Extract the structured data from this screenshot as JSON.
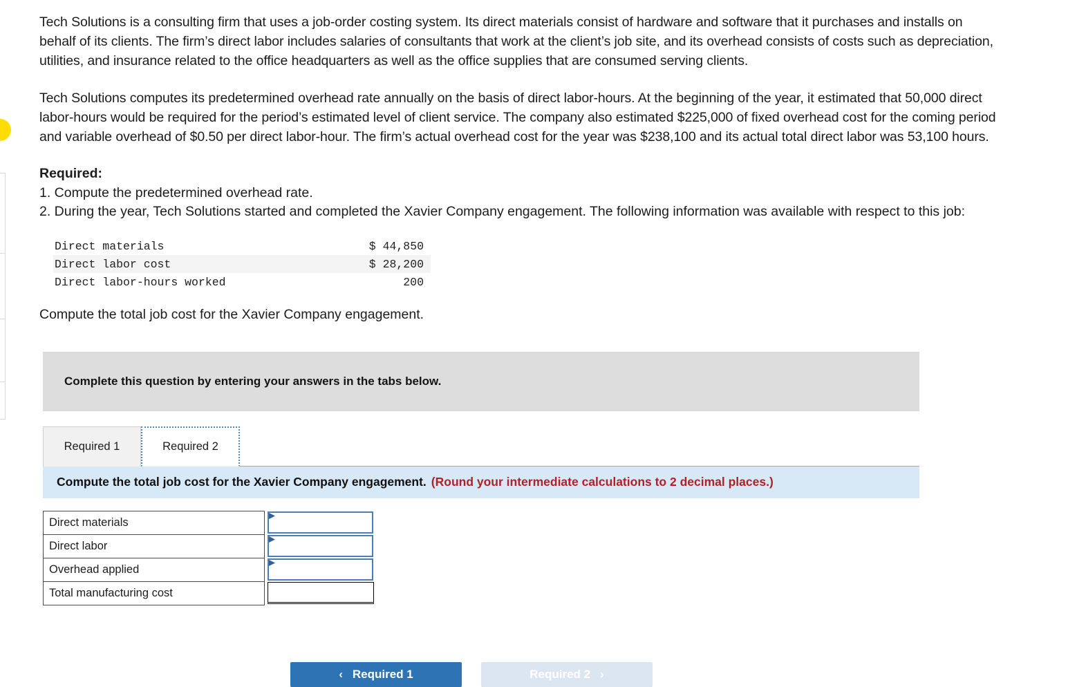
{
  "problem": {
    "paragraph_1": "Tech Solutions is a consulting firm that uses a job-order costing system. Its direct materials consist of hardware and software that it purchases and installs on behalf of its clients. The firm’s direct labor includes salaries of consultants that work at the client’s job site, and its overhead consists of costs such as depreciation, utilities, and insurance related to the office headquarters as well as the office supplies that are consumed serving clients.",
    "paragraph_2": "Tech Solutions computes its predetermined overhead rate annually on the basis of direct labor-hours. At the beginning of the year, it estimated that 50,000 direct labor-hours would be required for the period’s estimated level of client service. The company also estimated $225,000 of fixed overhead cost for the coming period and variable overhead of $0.50 per direct labor-hour. The firm’s actual overhead cost for the year was $238,100 and its actual total direct labor was 53,100 hours.",
    "required_heading": "Required:",
    "requirement_1": "1. Compute the predetermined overhead rate.",
    "requirement_2": "2. During the year, Tech Solutions started and completed the Xavier Company engagement. The following information was available with respect to this job:",
    "lead_line": "Compute the total job cost for the Xavier Company engagement."
  },
  "job_facts": {
    "rows": [
      {
        "label": "Direct materials",
        "value": "$ 44,850"
      },
      {
        "label": "Direct labor cost",
        "value": "$ 28,200"
      },
      {
        "label": "Direct labor-hours worked",
        "value": "200"
      }
    ]
  },
  "complete_banner": {
    "text": "Complete this question by entering your answers in the tabs below."
  },
  "tabs": [
    {
      "label": "Required 1",
      "active": false
    },
    {
      "label": "Required 2",
      "active": true
    }
  ],
  "instruction_bar": {
    "main": "Compute the total job cost for the Xavier Company engagement.",
    "note": "(Round your intermediate calculations to 2 decimal places.)"
  },
  "answer_table": {
    "rows": [
      {
        "label": "Direct materials",
        "value": "",
        "is_total": false
      },
      {
        "label": "Direct labor",
        "value": "",
        "is_total": false
      },
      {
        "label": "Overhead applied",
        "value": "",
        "is_total": false
      },
      {
        "label": "Total manufacturing cost",
        "value": "",
        "is_total": true
      }
    ]
  },
  "nav": {
    "prev_label": "Required 1",
    "prev_chevron": "‹",
    "next_label": "Required 2",
    "next_chevron": "›"
  },
  "colors": {
    "accent_blue": "#2e74b5",
    "instruction_bg": "#d7e9f7",
    "note_red": "#b32025",
    "banner_gray": "#dddddd",
    "field_border": "#4a7ebb",
    "highlight_yellow": "#ffdd00"
  }
}
